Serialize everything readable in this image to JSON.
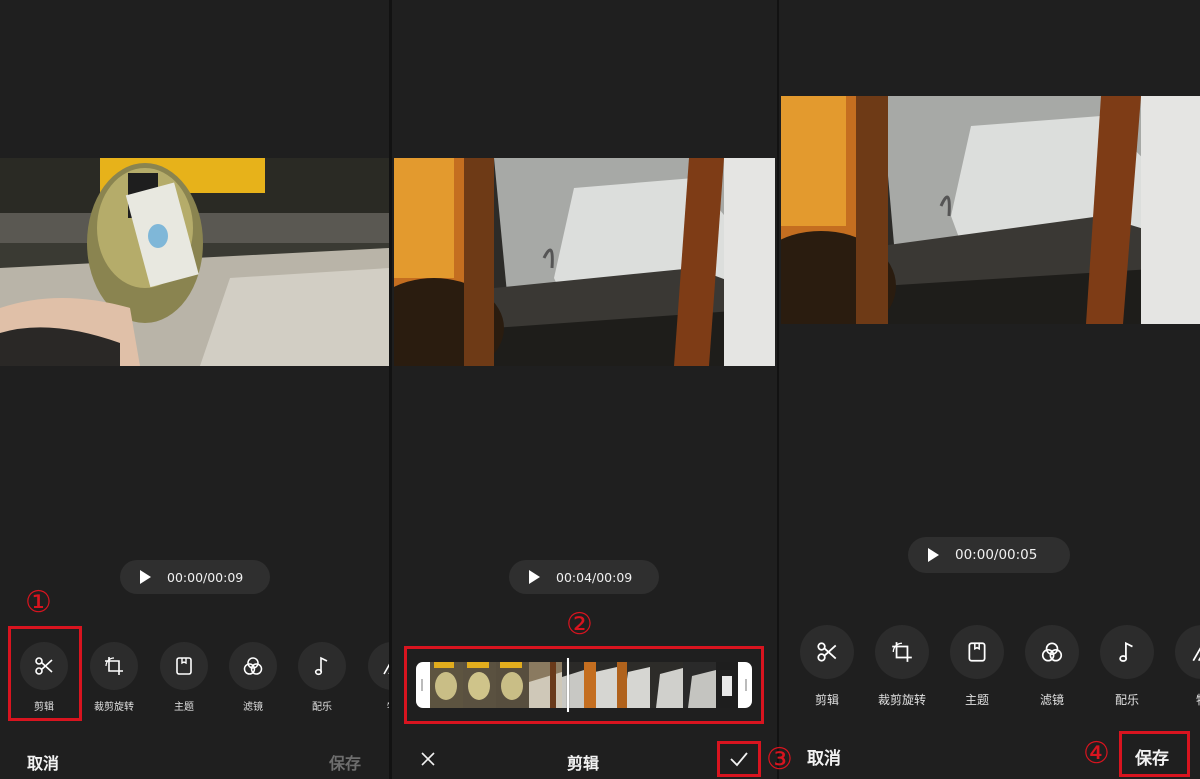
{
  "panel1": {
    "time": "00:00/00:09",
    "tools": [
      "剪辑",
      "裁剪旋转",
      "主题",
      "滤镜",
      "配乐",
      "特"
    ],
    "cancel": "取消",
    "save": "保存"
  },
  "panel2": {
    "time": "00:04/00:09",
    "title": "剪辑",
    "close_icon": "close-icon",
    "confirm_icon": "check-icon"
  },
  "panel3": {
    "time": "00:00/00:05",
    "tools": [
      "剪辑",
      "裁剪旋转",
      "主题",
      "滤镜",
      "配乐",
      "特"
    ],
    "cancel": "取消",
    "save": "保存"
  },
  "steps": [
    "①",
    "②",
    "③",
    "④"
  ],
  "colors": {
    "accent_red": "#d8141f",
    "background": "#1f1f1f",
    "save_disabled": "#6e6e6e"
  }
}
